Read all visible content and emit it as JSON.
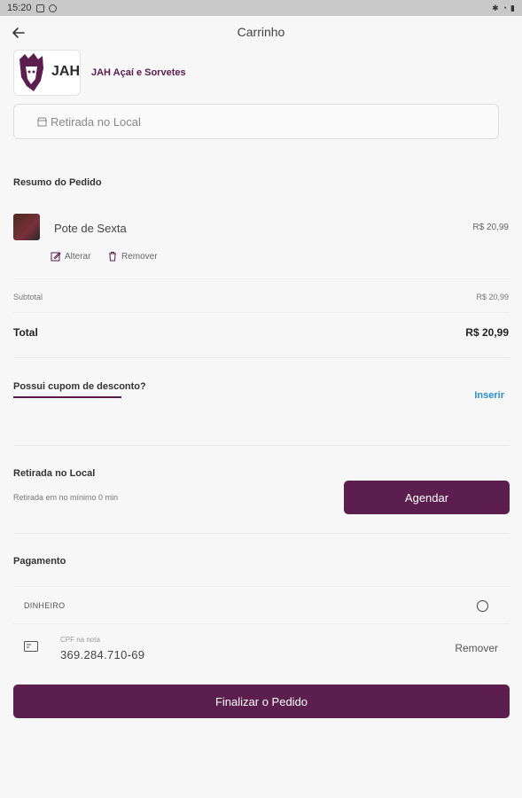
{
  "status_bar": {
    "time": "15:20"
  },
  "header": {
    "title": "Carrinho"
  },
  "store": {
    "logo_text": "JAH",
    "name": "JAH Açaí e Sorvetes"
  },
  "pickup_field": {
    "label": "Retirada no Local"
  },
  "summary": {
    "title": "Resumo do Pedido",
    "items": [
      {
        "name": "Pote de Sexta",
        "price": "R$ 20,99",
        "edit_label": "Alterar",
        "remove_label": "Remover"
      }
    ],
    "subtotal_label": "Subtotal",
    "subtotal_value": "R$ 20,99",
    "total_label": "Total",
    "total_value": "R$ 20,99"
  },
  "coupon": {
    "question": "Possui cupom de desconto?",
    "action": "Inserir"
  },
  "pickup": {
    "title": "Retirada no Local",
    "subtitle": "Retirada em no mínimo 0 min",
    "schedule_button": "Agendar"
  },
  "payment": {
    "title": "Pagamento",
    "method": "DINHEIRO",
    "cpf_label": "CPF na nota",
    "cpf_value": "369.284.710-69",
    "cpf_remove": "Remover"
  },
  "finalize_button": "Finalizar o Pedido",
  "colors": {
    "brand": "#5c1d4f",
    "link": "#2a8bd0"
  }
}
